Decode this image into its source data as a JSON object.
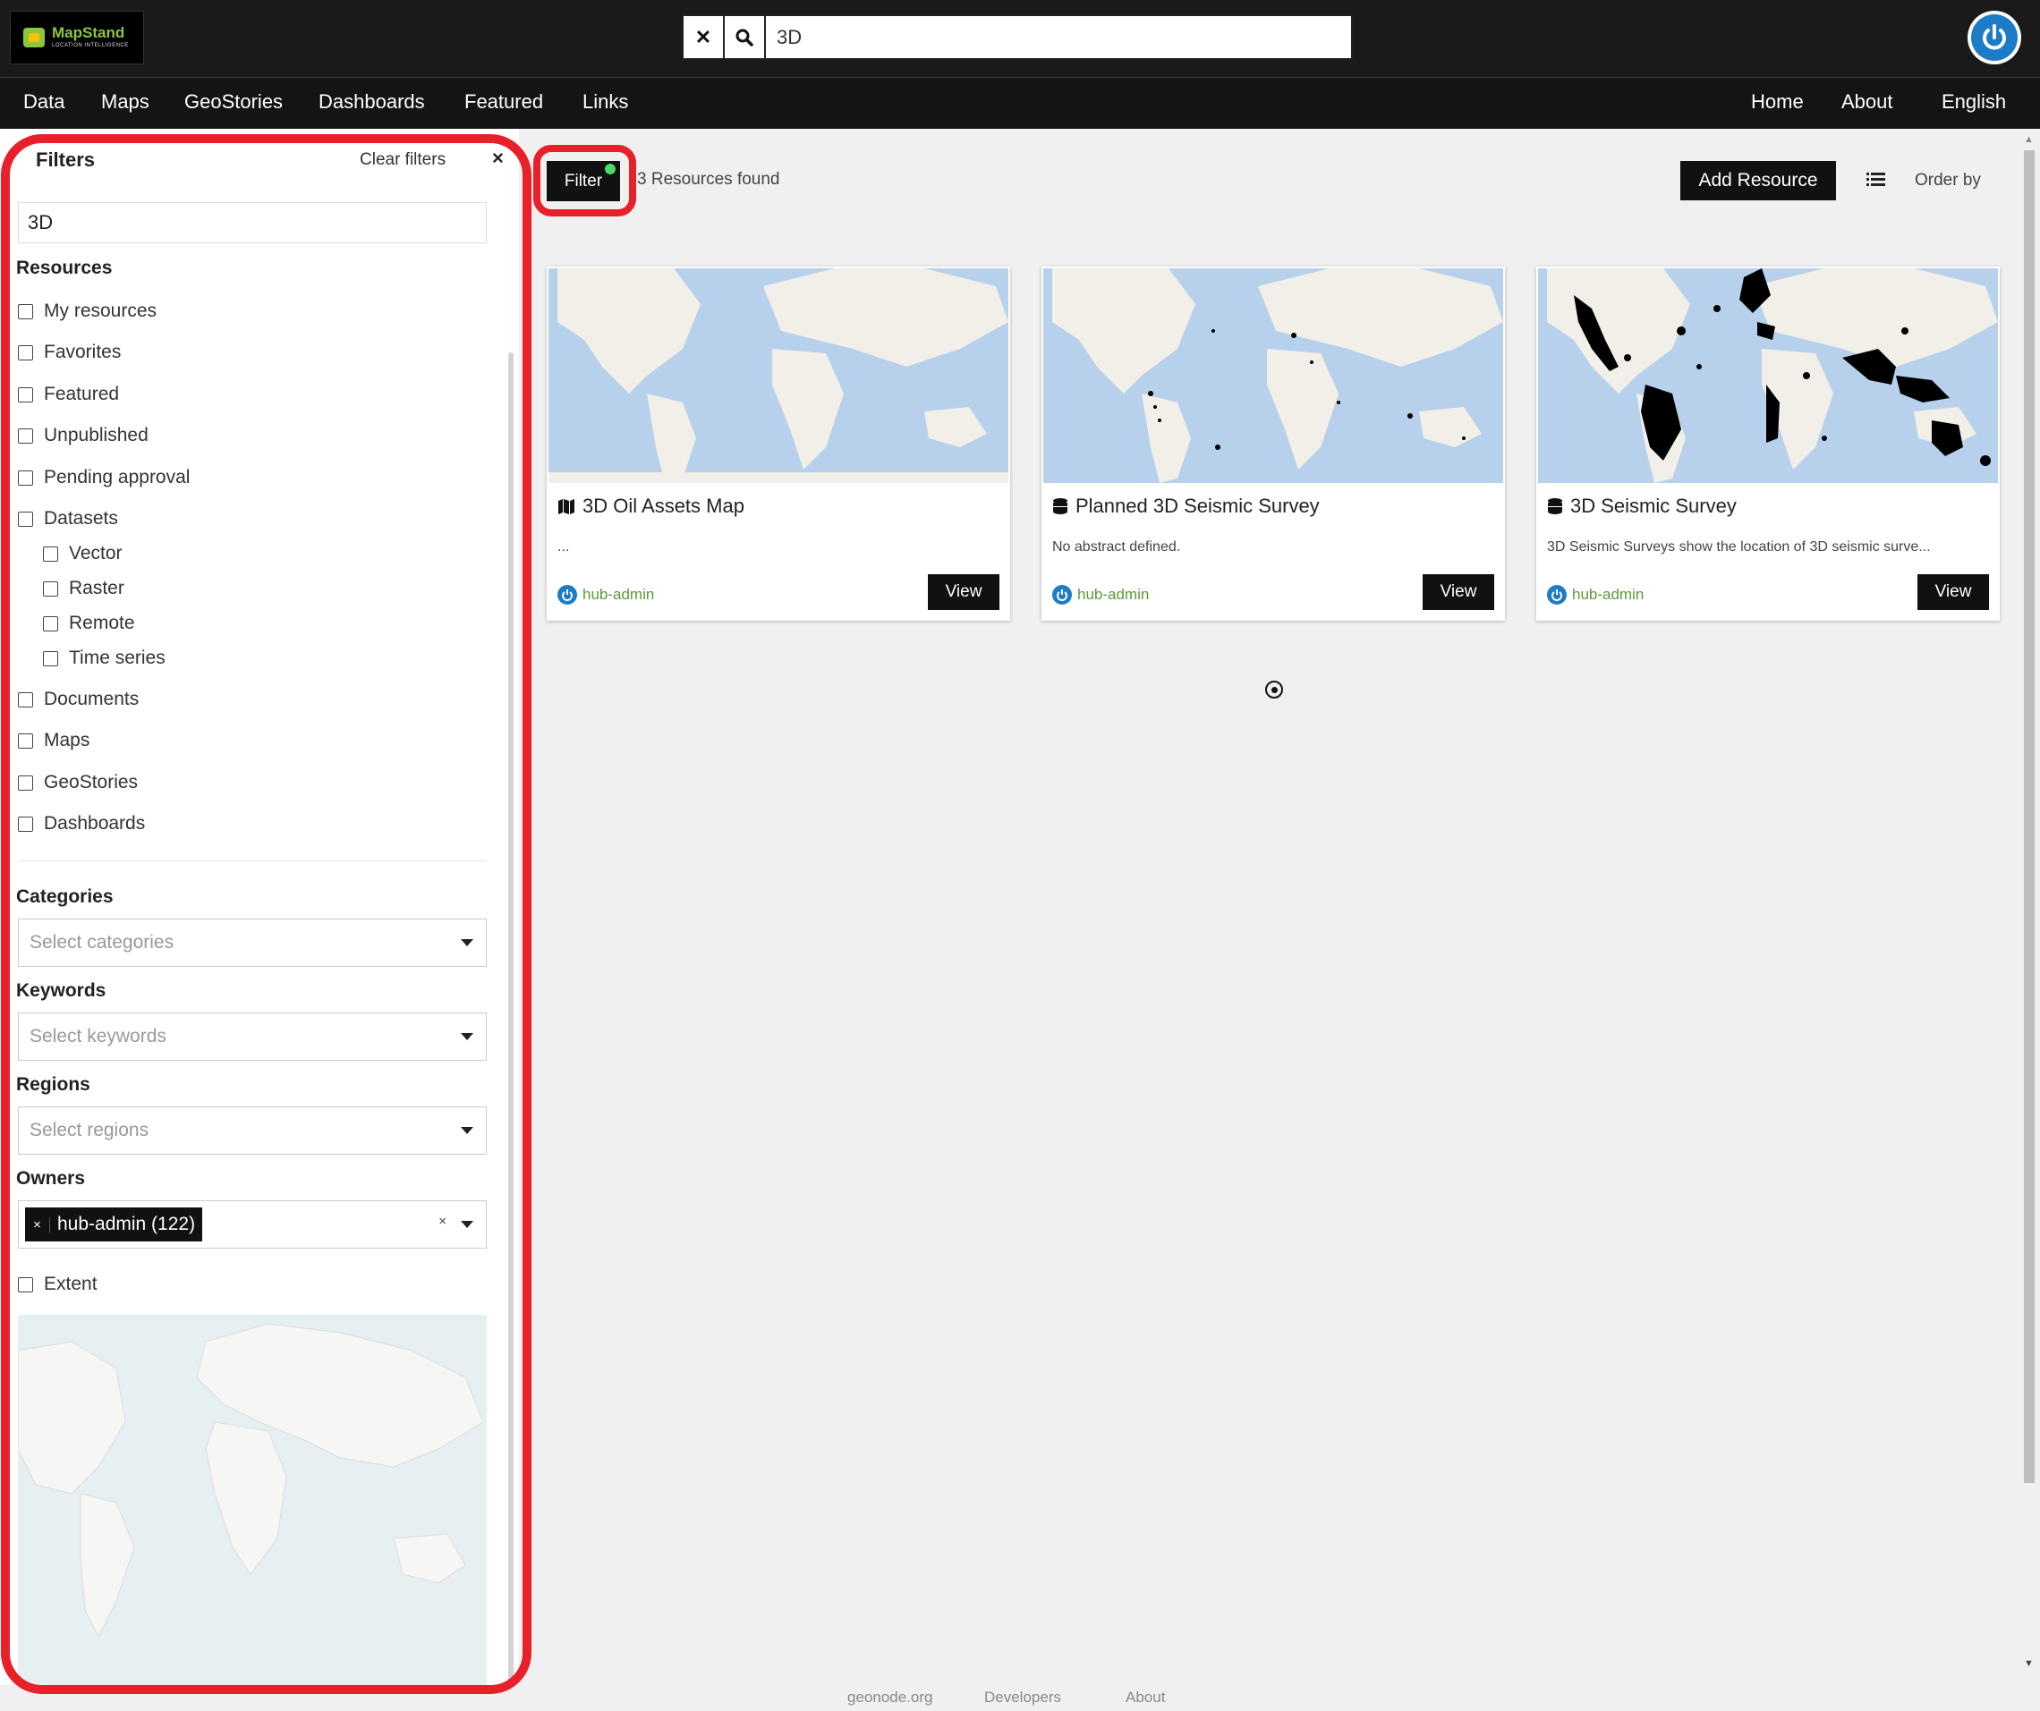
{
  "logo": {
    "name": "MapStand",
    "tagline": "LOCATION INTELLIGENCE"
  },
  "search": {
    "value": "3D",
    "clear_icon": "close-icon",
    "search_icon": "search-icon"
  },
  "nav": {
    "left": [
      "Data",
      "Maps",
      "GeoStories",
      "Dashboards",
      "Featured",
      "Links"
    ],
    "right": [
      "Home",
      "About",
      "English"
    ]
  },
  "filters": {
    "title": "Filters",
    "clear_label": "Clear filters",
    "close_label": "×",
    "search_value": "3D",
    "resources_heading": "Resources",
    "resources": [
      "My resources",
      "Favorites",
      "Featured",
      "Unpublished",
      "Pending approval",
      "Datasets"
    ],
    "dataset_types": [
      "Vector",
      "Raster",
      "Remote",
      "Time series"
    ],
    "more_resources": [
      "Documents",
      "Maps",
      "GeoStories",
      "Dashboards"
    ],
    "categories_heading": "Categories",
    "categories_placeholder": "Select categories",
    "keywords_heading": "Keywords",
    "keywords_placeholder": "Select keywords",
    "regions_heading": "Regions",
    "regions_placeholder": "Select regions",
    "owners_heading": "Owners",
    "owner_tag": "hub-admin (122)",
    "owner_tag_remove": "×",
    "owner_clear": "×",
    "extent_label": "Extent"
  },
  "toolbar": {
    "filter_label": "Filter",
    "results_text": "3 Resources found",
    "add_resource_label": "Add Resource",
    "order_by_label": "Order by"
  },
  "cards": [
    {
      "type_icon": "map-icon",
      "title": "3D Oil Assets Map",
      "abstract": "...",
      "owner": "hub-admin",
      "view_label": "View"
    },
    {
      "type_icon": "database-icon",
      "title": "Planned 3D Seismic Survey",
      "abstract": "No abstract defined.",
      "owner": "hub-admin",
      "view_label": "View"
    },
    {
      "type_icon": "database-icon",
      "title": "3D Seismic Survey",
      "abstract": "3D Seismic Surveys show the location of 3D seismic surve...",
      "owner": "hub-admin",
      "view_label": "View"
    }
  ],
  "footer": [
    "geonode.org",
    "Developers",
    "About"
  ],
  "colors": {
    "accent": "#1c7cc7",
    "annotation": "#e8202a",
    "owner_link": "#5b9a3b",
    "ocean": "#b7d1ec",
    "land": "#f2efe9"
  }
}
